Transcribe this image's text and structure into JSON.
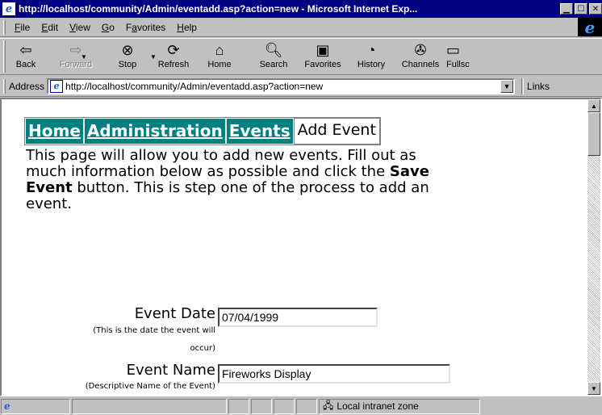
{
  "window": {
    "title": "http://localhost/community/Admin/eventadd.asp?action=new - Microsoft Internet Exp...",
    "app_icon": "ie-page-icon",
    "buttons": [
      "minimize",
      "maximize",
      "close"
    ]
  },
  "menu": {
    "items": [
      {
        "label": "File",
        "key": "F"
      },
      {
        "label": "Edit",
        "key": "E"
      },
      {
        "label": "View",
        "key": "V"
      },
      {
        "label": "Go",
        "key": "G"
      },
      {
        "label": "Favorites",
        "key": "a"
      },
      {
        "label": "Help",
        "key": "H"
      }
    ]
  },
  "toolbar": {
    "back": "Back",
    "forward": "Forward",
    "stop": "Stop",
    "refresh": "Refresh",
    "home": "Home",
    "search": "Search",
    "favorites": "Favorites",
    "history": "History",
    "channels": "Channels",
    "fullscreen": "Fullsc"
  },
  "address": {
    "label": "Address",
    "url": "http://localhost/community/Admin/eventadd.asp?action=new",
    "links": "Links"
  },
  "page": {
    "nav": {
      "home": "Home",
      "administration": "Administration",
      "events": "Events",
      "current": "Add Event"
    },
    "intro_prefix": "This page will allow you to add new events. Fill out as much information below as possible and click the ",
    "intro_bold": "Save Event",
    "intro_suffix": " button. This is step one of the process to add an event.",
    "fields": {
      "event_date": {
        "label": "Event Date",
        "hint_line1": "(This is the date the event will",
        "hint_line2": "occur)",
        "value": "07/04/1999"
      },
      "event_name": {
        "label": "Event Name",
        "hint_line1": "(Descriptive Name of the Event)",
        "value": "Fireworks Display"
      }
    }
  },
  "status": {
    "zone": "Local intranet zone"
  },
  "colors": {
    "titlebar": "#000080",
    "nav_bg": "#008080",
    "chrome": "#c0c0c0"
  }
}
